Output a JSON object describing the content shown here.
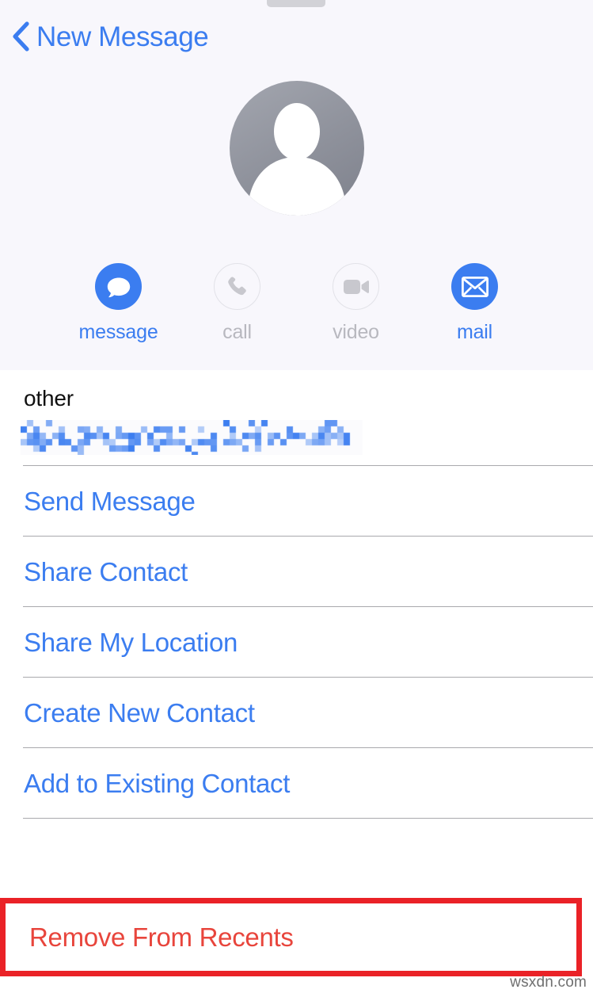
{
  "header": {
    "back_label": "New Message",
    "back_icon": "chevron-left-icon",
    "grabber": "sheet-grabber-handle",
    "avatar_icon": "person-placeholder-icon",
    "accent_color": "#3b7df0",
    "background_color": "#f8f7fc"
  },
  "actions": [
    {
      "label": "message",
      "icon": "message-bubble-icon",
      "enabled": true
    },
    {
      "label": "call",
      "icon": "phone-icon",
      "enabled": false
    },
    {
      "label": "video",
      "icon": "video-camera-icon",
      "enabled": false
    },
    {
      "label": "mail",
      "icon": "envelope-icon",
      "enabled": true
    }
  ],
  "contact_field": {
    "label": "other",
    "value": "",
    "value_state": "pixelated-redacted-email",
    "value_color": "#3b7df0"
  },
  "menu_items": [
    {
      "label": "Send Message"
    },
    {
      "label": "Share Contact"
    },
    {
      "label": "Share My Location"
    },
    {
      "label": "Create New Contact"
    },
    {
      "label": "Add to Existing Contact"
    }
  ],
  "destructive": {
    "label": "Remove From Recents",
    "color": "#e8453c",
    "annotation_color": "#ea2227"
  },
  "watermark": "wsxdn.com"
}
